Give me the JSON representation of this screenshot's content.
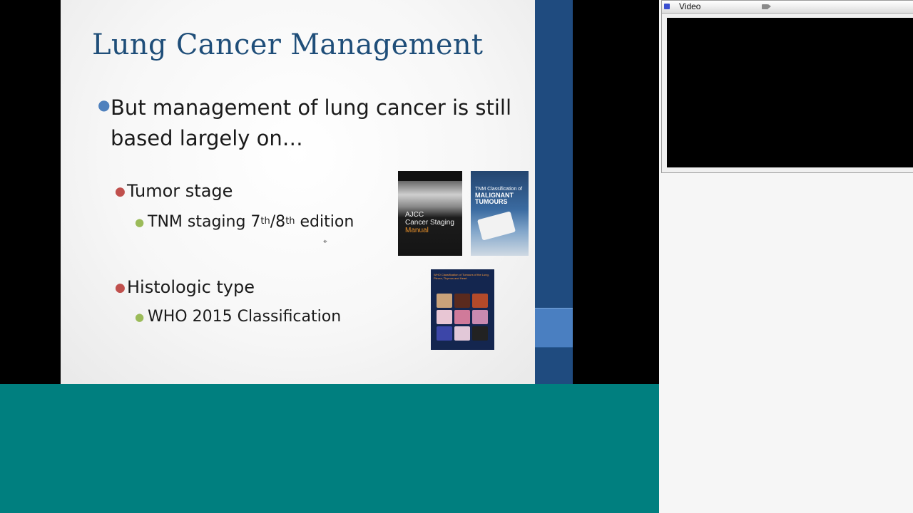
{
  "slide": {
    "title": "Lung Cancer Management",
    "bullet_main_line1": "But management of lung cancer is still",
    "bullet_main_line2": "based largely on…",
    "tumor_stage": "Tumor stage",
    "tnm_prefix": "TNM staging 7",
    "tnm_sup1": "th",
    "tnm_mid": "/8",
    "tnm_sup2": "th",
    "tnm_suffix": " edition",
    "histologic_type": "Histologic type",
    "who_classification": "WHO 2015 Classification",
    "books": {
      "ajcc_line1": "AJCC",
      "ajcc_line2": "Cancer Staging",
      "ajcc_line3": "Manual",
      "tnm_line1": "TNM Classification of",
      "tnm_line2": "MALIGNANT",
      "tnm_line3": "TUMOURS",
      "who_title": "WHO Classification of Tumours of the Lung, Pleura, Thymus and Heart"
    }
  },
  "video_panel": {
    "title": "Video",
    "status_icon": "window-status-icon",
    "camera_icon": "camera-icon"
  },
  "colors": {
    "title": "#1f4e79",
    "teal_bar": "#007f7f",
    "slide_edge": "#1f4b7f"
  }
}
